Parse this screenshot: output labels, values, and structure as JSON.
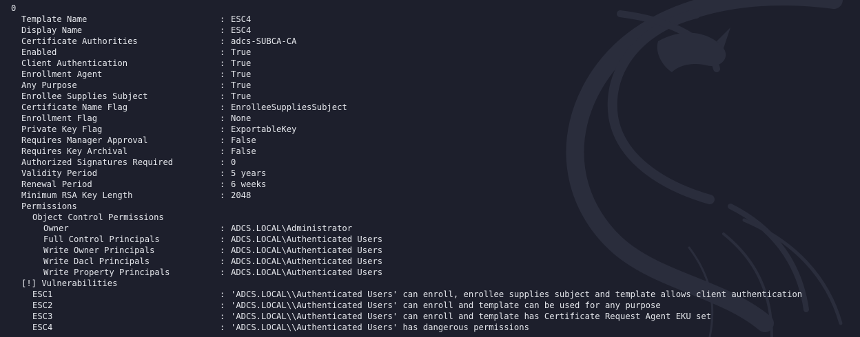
{
  "record_index": "0",
  "partial_top_line": "    ...    ",
  "separator": ":",
  "fields": [
    {
      "label": "Template Name",
      "value": "ESC4",
      "indent": 1
    },
    {
      "label": "Display Name",
      "value": "ESC4",
      "indent": 1
    },
    {
      "label": "Certificate Authorities",
      "value": "adcs-SUBCA-CA",
      "indent": 1
    },
    {
      "label": "Enabled",
      "value": "True",
      "indent": 1
    },
    {
      "label": "Client Authentication",
      "value": "True",
      "indent": 1
    },
    {
      "label": "Enrollment Agent",
      "value": "True",
      "indent": 1
    },
    {
      "label": "Any Purpose",
      "value": "True",
      "indent": 1
    },
    {
      "label": "Enrollee Supplies Subject",
      "value": "True",
      "indent": 1
    },
    {
      "label": "Certificate Name Flag",
      "value": "EnrolleeSuppliesSubject",
      "indent": 1
    },
    {
      "label": "Enrollment Flag",
      "value": "None",
      "indent": 1
    },
    {
      "label": "Private Key Flag",
      "value": "ExportableKey",
      "indent": 1
    },
    {
      "label": "Requires Manager Approval",
      "value": "False",
      "indent": 1
    },
    {
      "label": "Requires Key Archival",
      "value": "False",
      "indent": 1
    },
    {
      "label": "Authorized Signatures Required",
      "value": "0",
      "indent": 1
    },
    {
      "label": "Validity Period",
      "value": "5 years",
      "indent": 1
    },
    {
      "label": "Renewal Period",
      "value": "6 weeks",
      "indent": 1
    },
    {
      "label": "Minimum RSA Key Length",
      "value": "2048",
      "indent": 1
    },
    {
      "label": "Permissions",
      "value": null,
      "indent": 1
    },
    {
      "label": "Object Control Permissions",
      "value": null,
      "indent": 2
    },
    {
      "label": "Owner",
      "value": "ADCS.LOCAL\\Administrator",
      "indent": 3
    },
    {
      "label": "Full Control Principals",
      "value": "ADCS.LOCAL\\Authenticated Users",
      "indent": 3
    },
    {
      "label": "Write Owner Principals",
      "value": "ADCS.LOCAL\\Authenticated Users",
      "indent": 3
    },
    {
      "label": "Write Dacl Principals",
      "value": "ADCS.LOCAL\\Authenticated Users",
      "indent": 3
    },
    {
      "label": "Write Property Principals",
      "value": "ADCS.LOCAL\\Authenticated Users",
      "indent": 3
    },
    {
      "label": "[!] Vulnerabilities",
      "value": null,
      "indent": 1
    },
    {
      "label": "ESC1",
      "value": "'ADCS.LOCAL\\\\Authenticated Users' can enroll, enrollee supplies subject and template allows client authentication",
      "indent": 2
    },
    {
      "label": "ESC2",
      "value": "'ADCS.LOCAL\\\\Authenticated Users' can enroll and template can be used for any purpose",
      "indent": 2
    },
    {
      "label": "ESC3",
      "value": "'ADCS.LOCAL\\\\Authenticated Users' can enroll and template has Certificate Request Agent EKU set",
      "indent": 2
    },
    {
      "label": "ESC4",
      "value": "'ADCS.LOCAL\\\\Authenticated Users' has dangerous permissions",
      "indent": 2
    }
  ],
  "colors": {
    "background": "#1d1f2c",
    "text": "#e3e5ea",
    "watermark": "#2a2d3c"
  }
}
